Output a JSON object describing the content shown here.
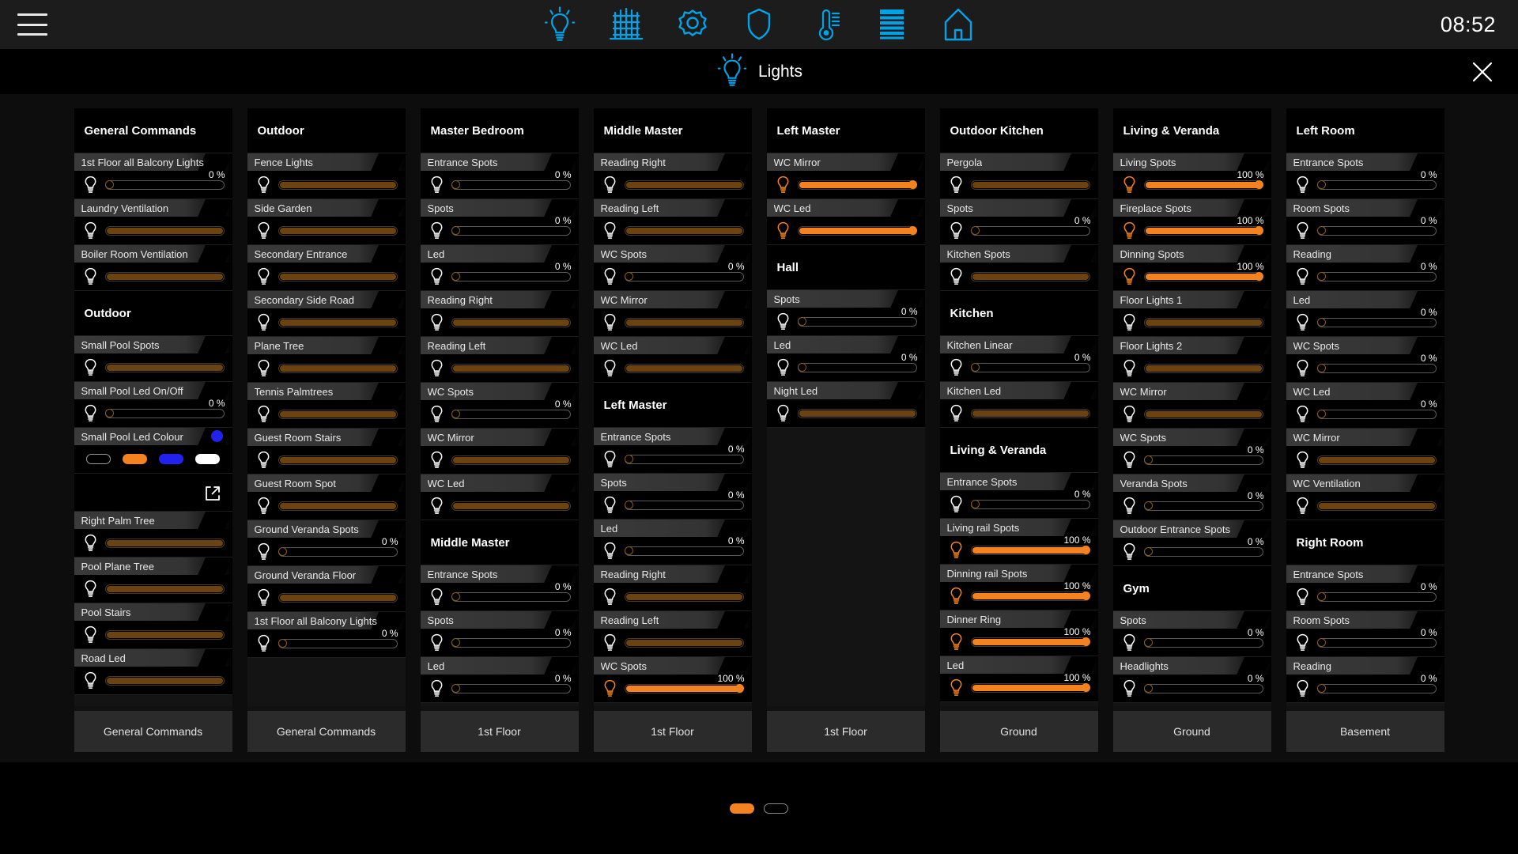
{
  "topbar": {
    "clock": "08:52",
    "menu_label": "menu",
    "icons": [
      {
        "name": "bulb-icon",
        "label": "Lights"
      },
      {
        "name": "gate-icon",
        "label": "Gates"
      },
      {
        "name": "gear-icon",
        "label": "Settings"
      },
      {
        "name": "shield-icon",
        "label": "Security"
      },
      {
        "name": "thermometer-icon",
        "label": "Climate"
      },
      {
        "name": "blinds-icon",
        "label": "Blinds"
      },
      {
        "name": "house-icon",
        "label": "Home"
      }
    ]
  },
  "page": {
    "title": "Lights",
    "close_label": "×",
    "accent": "#f58220",
    "accent_dim": "#6b4310",
    "brand_blue": "#00a3e8"
  },
  "pager": {
    "dots": [
      {
        "active": true
      },
      {
        "active": false
      }
    ]
  },
  "columns": [
    {
      "footer": "General Commands",
      "blocks": [
        {
          "type": "group",
          "label": "General Commands"
        },
        {
          "type": "row",
          "label": "1st Floor all Balcony Lights",
          "pct": "0 %",
          "on": false,
          "value": 0
        },
        {
          "type": "row",
          "label": "Laundry Ventilation",
          "pct": null,
          "on": false,
          "value": 100
        },
        {
          "type": "row",
          "label": "Boiler Room Ventilation",
          "pct": null,
          "on": false,
          "value": 100
        },
        {
          "type": "group",
          "label": "Outdoor"
        },
        {
          "type": "row",
          "label": "Small Pool Spots",
          "pct": null,
          "on": false,
          "value": 100
        },
        {
          "type": "row",
          "label": "Small Pool Led On/Off",
          "pct": "0 %",
          "on": false,
          "value": 0
        },
        {
          "type": "swatches",
          "label": "Small Pool Led Colour",
          "dot": "#2222ee",
          "items": [
            {
              "name": "swatch-off",
              "color": "none"
            },
            {
              "name": "swatch-orange",
              "color": "orange"
            },
            {
              "name": "swatch-blue",
              "color": "blue"
            },
            {
              "name": "swatch-white",
              "color": "white"
            }
          ]
        },
        {
          "type": "link",
          "label": "open-external"
        },
        {
          "type": "row",
          "label": "Right Palm Tree",
          "pct": null,
          "on": false,
          "value": 100
        },
        {
          "type": "row",
          "label": "Pool Plane Tree",
          "pct": null,
          "on": false,
          "value": 100
        },
        {
          "type": "row",
          "label": "Pool Stairs",
          "pct": null,
          "on": false,
          "value": 100
        },
        {
          "type": "row",
          "label": "Road Led",
          "pct": null,
          "on": false,
          "value": 100
        }
      ]
    },
    {
      "footer": "General Commands",
      "blocks": [
        {
          "type": "group",
          "label": "Outdoor"
        },
        {
          "type": "row",
          "label": "Fence Lights",
          "pct": null,
          "on": false,
          "value": 100
        },
        {
          "type": "row",
          "label": "Side Garden",
          "pct": null,
          "on": false,
          "value": 100
        },
        {
          "type": "row",
          "label": "Secondary Entrance",
          "pct": null,
          "on": false,
          "value": 100
        },
        {
          "type": "row",
          "label": "Secondary Side Road",
          "pct": null,
          "on": false,
          "value": 100
        },
        {
          "type": "row",
          "label": "Plane Tree",
          "pct": null,
          "on": false,
          "value": 100
        },
        {
          "type": "row",
          "label": "Tennis Palmtrees",
          "pct": null,
          "on": false,
          "value": 100
        },
        {
          "type": "row",
          "label": "Guest Room Stairs",
          "pct": null,
          "on": false,
          "value": 100
        },
        {
          "type": "row",
          "label": "Guest Room Spot",
          "pct": null,
          "on": false,
          "value": 100
        },
        {
          "type": "row",
          "label": "Ground Veranda Spots",
          "pct": "0 %",
          "on": false,
          "value": 0
        },
        {
          "type": "row",
          "label": "Ground Veranda Floor",
          "pct": null,
          "on": false,
          "value": 100
        },
        {
          "type": "row",
          "label": "1st Floor all Balcony Lights",
          "pct": "0 %",
          "on": false,
          "value": 0
        }
      ]
    },
    {
      "footer": "1st Floor",
      "blocks": [
        {
          "type": "group",
          "label": "Master Bedroom"
        },
        {
          "type": "row",
          "label": "Entrance Spots",
          "pct": "0 %",
          "on": false,
          "value": 0
        },
        {
          "type": "row",
          "label": "Spots",
          "pct": "0 %",
          "on": false,
          "value": 0
        },
        {
          "type": "row",
          "label": "Led",
          "pct": "0 %",
          "on": false,
          "value": 0
        },
        {
          "type": "row",
          "label": "Reading Right",
          "pct": null,
          "on": false,
          "value": 100
        },
        {
          "type": "row",
          "label": "Reading Left",
          "pct": null,
          "on": false,
          "value": 100
        },
        {
          "type": "row",
          "label": "WC Spots",
          "pct": "0 %",
          "on": false,
          "value": 0
        },
        {
          "type": "row",
          "label": "WC Mirror",
          "pct": null,
          "on": false,
          "value": 100
        },
        {
          "type": "row",
          "label": "WC Led",
          "pct": null,
          "on": false,
          "value": 100
        },
        {
          "type": "group",
          "label": "Middle Master"
        },
        {
          "type": "row",
          "label": "Entrance Spots",
          "pct": "0 %",
          "on": false,
          "value": 0
        },
        {
          "type": "row",
          "label": "Spots",
          "pct": "0 %",
          "on": false,
          "value": 0
        },
        {
          "type": "row",
          "label": "Led",
          "pct": "0 %",
          "on": false,
          "value": 0
        }
      ]
    },
    {
      "footer": "1st Floor",
      "blocks": [
        {
          "type": "group",
          "label": "Middle Master"
        },
        {
          "type": "row",
          "label": "Reading Right",
          "pct": null,
          "on": false,
          "value": 100
        },
        {
          "type": "row",
          "label": "Reading Left",
          "pct": null,
          "on": false,
          "value": 100
        },
        {
          "type": "row",
          "label": "WC Spots",
          "pct": "0 %",
          "on": false,
          "value": 0
        },
        {
          "type": "row",
          "label": "WC Mirror",
          "pct": null,
          "on": false,
          "value": 100
        },
        {
          "type": "row",
          "label": "WC Led",
          "pct": null,
          "on": false,
          "value": 100
        },
        {
          "type": "group",
          "label": "Left Master"
        },
        {
          "type": "row",
          "label": "Entrance Spots",
          "pct": "0 %",
          "on": false,
          "value": 0
        },
        {
          "type": "row",
          "label": "Spots",
          "pct": "0 %",
          "on": false,
          "value": 0
        },
        {
          "type": "row",
          "label": "Led",
          "pct": "0 %",
          "on": false,
          "value": 0
        },
        {
          "type": "row",
          "label": "Reading Right",
          "pct": null,
          "on": false,
          "value": 100
        },
        {
          "type": "row",
          "label": "Reading Left",
          "pct": null,
          "on": false,
          "value": 100
        },
        {
          "type": "row",
          "label": "WC Spots",
          "pct": "100 %",
          "on": true,
          "value": 100
        }
      ]
    },
    {
      "footer": "1st Floor",
      "blocks": [
        {
          "type": "group",
          "label": "Left Master"
        },
        {
          "type": "row",
          "label": "WC Mirror",
          "pct": null,
          "on": true,
          "value": 100
        },
        {
          "type": "row",
          "label": "WC Led",
          "pct": null,
          "on": true,
          "value": 100
        },
        {
          "type": "group",
          "label": "Hall"
        },
        {
          "type": "row",
          "label": "Spots",
          "pct": "0 %",
          "on": false,
          "value": 0
        },
        {
          "type": "row",
          "label": "Led",
          "pct": "0 %",
          "on": false,
          "value": 0
        },
        {
          "type": "row",
          "label": "Night Led",
          "pct": null,
          "on": false,
          "value": 100
        }
      ]
    },
    {
      "footer": "Ground",
      "blocks": [
        {
          "type": "group",
          "label": "Outdoor Kitchen"
        },
        {
          "type": "row",
          "label": "Pergola",
          "pct": null,
          "on": false,
          "value": 100
        },
        {
          "type": "row",
          "label": "Spots",
          "pct": "0 %",
          "on": false,
          "value": 0
        },
        {
          "type": "row",
          "label": "Kitchen Spots",
          "pct": null,
          "on": false,
          "value": 100
        },
        {
          "type": "group",
          "label": "Kitchen"
        },
        {
          "type": "row",
          "label": "Kitchen Linear",
          "pct": "0 %",
          "on": false,
          "value": 0
        },
        {
          "type": "row",
          "label": "Kitchen Led",
          "pct": null,
          "on": false,
          "value": 100
        },
        {
          "type": "group",
          "label": "Living & Veranda"
        },
        {
          "type": "row",
          "label": "Entrance Spots",
          "pct": "0 %",
          "on": false,
          "value": 0
        },
        {
          "type": "row",
          "label": "Living rail Spots",
          "pct": "100 %",
          "on": true,
          "value": 100
        },
        {
          "type": "row",
          "label": "Dinning rail Spots",
          "pct": "100 %",
          "on": true,
          "value": 100
        },
        {
          "type": "row",
          "label": "Dinner Ring",
          "pct": "100 %",
          "on": true,
          "value": 100
        },
        {
          "type": "row",
          "label": "Led",
          "pct": "100 %",
          "on": true,
          "value": 100
        }
      ]
    },
    {
      "footer": "Ground",
      "blocks": [
        {
          "type": "group",
          "label": "Living & Veranda"
        },
        {
          "type": "row",
          "label": "Living Spots",
          "pct": "100 %",
          "on": true,
          "value": 100
        },
        {
          "type": "row",
          "label": "Fireplace Spots",
          "pct": "100 %",
          "on": true,
          "value": 100
        },
        {
          "type": "row",
          "label": "Dinning Spots",
          "pct": "100 %",
          "on": true,
          "value": 100
        },
        {
          "type": "row",
          "label": "Floor Lights 1",
          "pct": null,
          "on": false,
          "value": 100
        },
        {
          "type": "row",
          "label": "Floor Lights 2",
          "pct": null,
          "on": false,
          "value": 100
        },
        {
          "type": "row",
          "label": "WC Mirror",
          "pct": null,
          "on": false,
          "value": 100
        },
        {
          "type": "row",
          "label": "WC Spots",
          "pct": "0 %",
          "on": false,
          "value": 0
        },
        {
          "type": "row",
          "label": "Veranda Spots",
          "pct": "0 %",
          "on": false,
          "value": 0
        },
        {
          "type": "row",
          "label": "Outdoor Entrance Spots",
          "pct": "0 %",
          "on": false,
          "value": 0
        },
        {
          "type": "group",
          "label": "Gym"
        },
        {
          "type": "row",
          "label": "Spots",
          "pct": "0 %",
          "on": false,
          "value": 0
        },
        {
          "type": "row",
          "label": "Headlights",
          "pct": "0 %",
          "on": false,
          "value": 0
        }
      ]
    },
    {
      "footer": "Basement",
      "blocks": [
        {
          "type": "group",
          "label": "Left Room"
        },
        {
          "type": "row",
          "label": "Entrance Spots",
          "pct": "0 %",
          "on": false,
          "value": 0
        },
        {
          "type": "row",
          "label": "Room Spots",
          "pct": "0 %",
          "on": false,
          "value": 0
        },
        {
          "type": "row",
          "label": "Reading",
          "pct": "0 %",
          "on": false,
          "value": 0
        },
        {
          "type": "row",
          "label": "Led",
          "pct": "0 %",
          "on": false,
          "value": 0
        },
        {
          "type": "row",
          "label": "WC Spots",
          "pct": "0 %",
          "on": false,
          "value": 0
        },
        {
          "type": "row",
          "label": "WC Led",
          "pct": "0 %",
          "on": false,
          "value": 0
        },
        {
          "type": "row",
          "label": "WC Mirror",
          "pct": null,
          "on": false,
          "value": 100
        },
        {
          "type": "row",
          "label": "WC Ventilation",
          "pct": null,
          "on": false,
          "value": 100
        },
        {
          "type": "group",
          "label": "Right Room"
        },
        {
          "type": "row",
          "label": "Entrance Spots",
          "pct": "0 %",
          "on": false,
          "value": 0
        },
        {
          "type": "row",
          "label": "Room Spots",
          "pct": "0 %",
          "on": false,
          "value": 0
        },
        {
          "type": "row",
          "label": "Reading",
          "pct": "0 %",
          "on": false,
          "value": 0
        }
      ]
    }
  ]
}
